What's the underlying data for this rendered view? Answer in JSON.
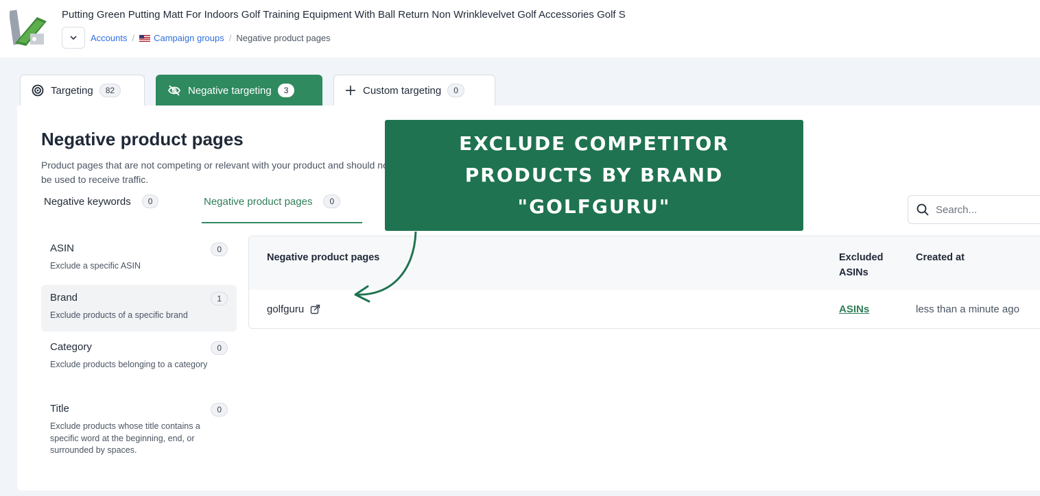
{
  "header": {
    "product_title": "Putting Green Putting Matt For Indoors Golf Training Equipment With Ball Return Non Wrinklevelvet Golf Accessories Golf S",
    "breadcrumb": {
      "accounts": "Accounts",
      "campaign_groups": "Campaign groups",
      "current": "Negative product pages"
    }
  },
  "tabs": [
    {
      "label": "Targeting",
      "count": "82",
      "icon": "target-icon"
    },
    {
      "label": "Negative targeting",
      "count": "3",
      "icon": "eye-off-icon"
    },
    {
      "label": "Custom targeting",
      "count": "0",
      "icon": "plus-icon"
    }
  ],
  "section": {
    "title": "Negative product pages",
    "description": "Product pages that are not competing or relevant with your product and should not be used to receive traffic."
  },
  "subtabs": [
    {
      "label": "Negative keywords",
      "count": "0"
    },
    {
      "label": "Negative product pages",
      "count": "0"
    }
  ],
  "search": {
    "placeholder": "Search..."
  },
  "filters": [
    {
      "name": "ASIN",
      "desc": "Exclude a specific ASIN",
      "count": "0"
    },
    {
      "name": "Brand",
      "desc": "Exclude products of a specific brand",
      "count": "1"
    },
    {
      "name": "Category",
      "desc": "Exclude products belonging to a category",
      "count": "0"
    },
    {
      "name": "Title",
      "desc": "Exclude products whose title contains a specific word at the beginning, end, or surrounded by spaces.",
      "count": "0"
    }
  ],
  "table": {
    "headers": {
      "name": "Negative product pages",
      "excluded": "Excluded ASINs",
      "created": "Created at"
    },
    "rows": [
      {
        "name": "golfguru",
        "excluded": "ASINs",
        "created": "less than a minute ago"
      }
    ]
  },
  "callout": {
    "text": "Exclude competitor products by brand \"golfguru\""
  },
  "colors": {
    "accent": "#2f8a5f",
    "callout": "#1f7350",
    "link": "#2f6fe0"
  }
}
